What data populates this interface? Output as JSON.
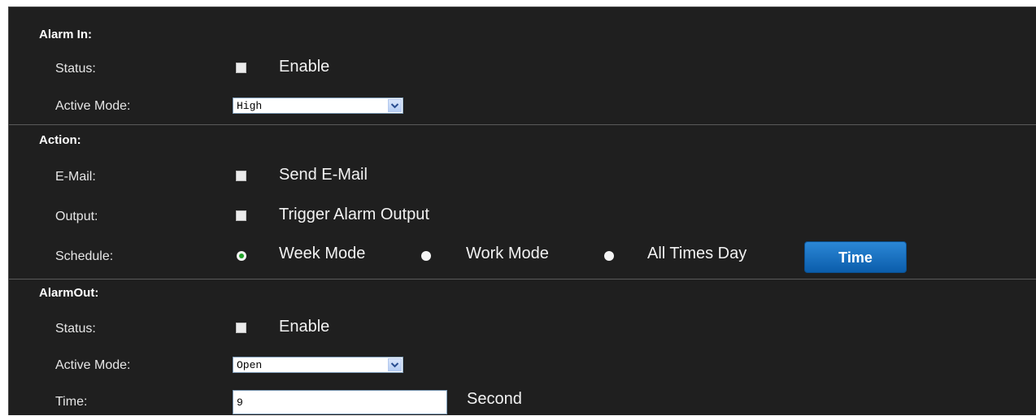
{
  "alarm_in": {
    "heading": "Alarm In:",
    "status_label": "Status:",
    "status_enable_label": "Enable",
    "status_enable_checked": false,
    "active_mode_label": "Active Mode:",
    "active_mode_value": "High"
  },
  "action": {
    "heading": "Action:",
    "email_label": "E-Mail:",
    "email_option_label": "Send E-Mail",
    "email_checked": false,
    "output_label": "Output:",
    "output_option_label": "Trigger Alarm Output",
    "output_checked": false,
    "schedule_label": "Schedule:",
    "schedule_options": [
      "Week Mode",
      "Work Mode",
      "All Times Day"
    ],
    "schedule_selected": "Week Mode",
    "time_button_label": "Time"
  },
  "alarm_out": {
    "heading": "AlarmOut:",
    "status_label": "Status:",
    "status_enable_label": "Enable",
    "status_enable_checked": false,
    "active_mode_label": "Active Mode:",
    "active_mode_value": "Open",
    "time_label": "Time:",
    "time_value": "9",
    "time_unit": "Second"
  },
  "colors": {
    "panel_background": "#1f1f1f",
    "button_blue": "#1a73c4",
    "radio_selected": "#22a22a"
  },
  "icons": {
    "select_arrow": "chevron-down-icon"
  }
}
